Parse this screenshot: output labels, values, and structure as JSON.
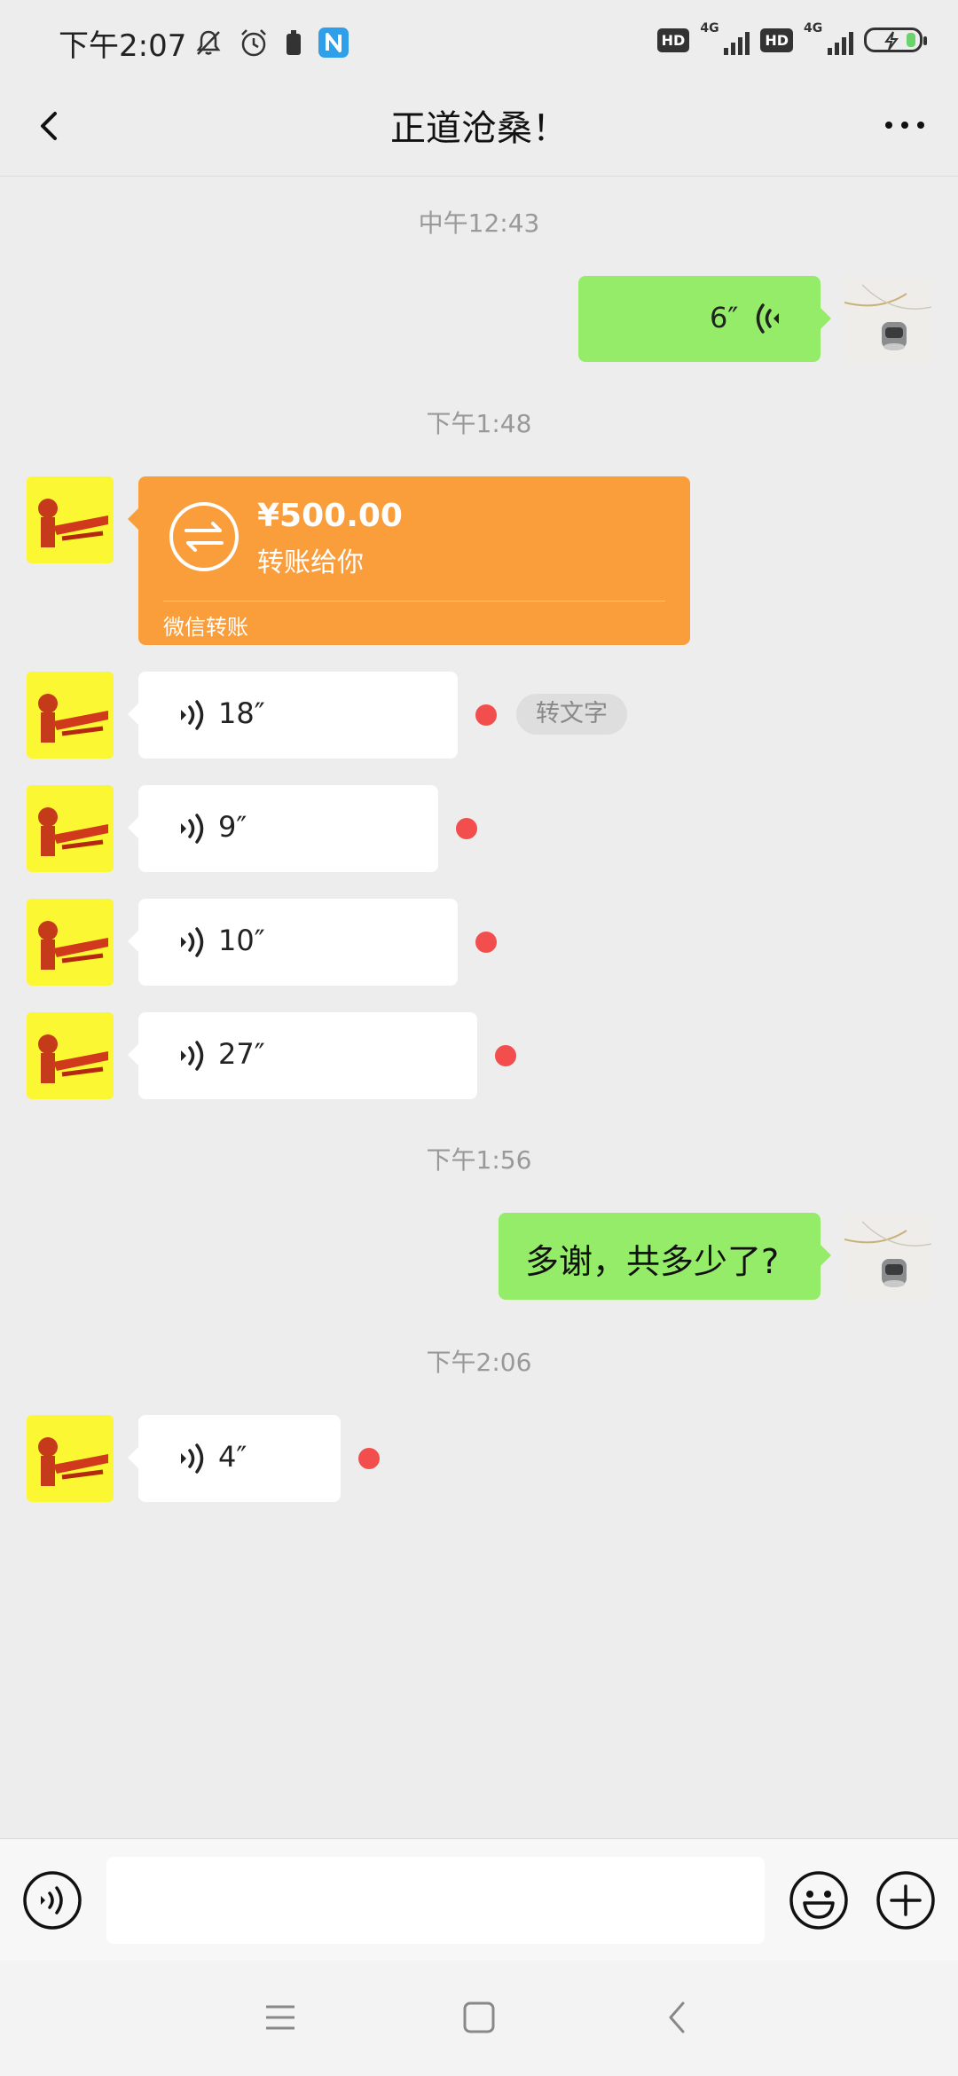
{
  "status_bar": {
    "time": "下午2:07",
    "left_icons": [
      "bell-off-icon",
      "alarm-icon",
      "battery-saver-icon",
      "app-n-icon"
    ],
    "right_icons": {
      "hd1": "HD",
      "net1": "4G",
      "hd2": "HD",
      "net2": "4G"
    },
    "battery_charging": true
  },
  "header": {
    "title": "正道沧桑！",
    "back_icon": "chevron-left-icon",
    "more_icon": "more-horizontal-icon"
  },
  "messages": {
    "ts1": "中午12:43",
    "m1_voice_duration": "6″",
    "ts2": "下午1:48",
    "transfer": {
      "amount": "¥500.00",
      "subtitle": "转账给你",
      "footer": "微信转账"
    },
    "v2_duration": "18″",
    "v2_to_text": "转文字",
    "v3_duration": "9″",
    "v4_duration": "10″",
    "v5_duration": "27″",
    "ts3": "下午1:56",
    "m6_text": "多谢，共多少了?",
    "ts4": "下午2:06",
    "v7_duration": "4″"
  },
  "input_bar": {
    "voice_icon": "voice-input-icon",
    "emoji_icon": "emoji-icon",
    "plus_icon": "plus-icon",
    "value": "",
    "placeholder": ""
  },
  "nav_bar": {
    "icons": [
      "menu-icon",
      "home-icon",
      "back-icon"
    ]
  },
  "colors": {
    "bg": "#EDEDED",
    "self_bubble": "#95EC69",
    "transfer": "#FA9D3B",
    "unread_dot": "#F24E4E"
  }
}
